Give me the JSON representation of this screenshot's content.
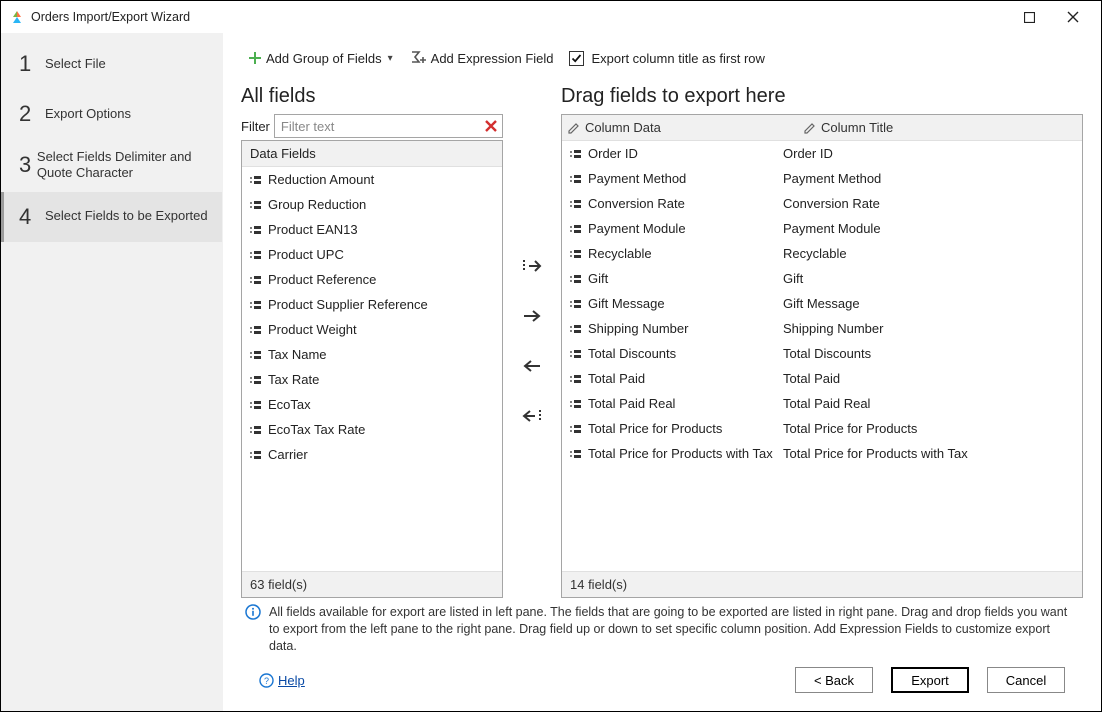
{
  "window": {
    "title": "Orders Import/Export Wizard"
  },
  "steps": [
    {
      "num": "1",
      "label": "Select File"
    },
    {
      "num": "2",
      "label": "Export Options"
    },
    {
      "num": "3",
      "label": "Select Fields Delimiter and Quote Character"
    },
    {
      "num": "4",
      "label": "Select Fields to be Exported"
    }
  ],
  "active_step_index": 3,
  "toolbar": {
    "add_group": "Add Group of Fields",
    "add_expr": "Add Expression Field",
    "export_first_row": "Export column title as first row",
    "export_first_row_checked": true
  },
  "left": {
    "title": "All fields",
    "filter_label": "Filter",
    "filter_placeholder": "Filter text",
    "header": "Data Fields",
    "items": [
      "Reduction Amount",
      "Group Reduction",
      "Product EAN13",
      "Product UPC",
      "Product Reference",
      "Product Supplier Reference",
      "Product Weight",
      "Tax Name",
      "Tax Rate",
      "EcoTax",
      "EcoTax Tax Rate",
      "Carrier"
    ],
    "count": "63 field(s)"
  },
  "right": {
    "title": "Drag fields to export here",
    "col1": "Column Data",
    "col2": "Column Title",
    "rows": [
      {
        "data": "Order ID",
        "title": "Order ID"
      },
      {
        "data": "Payment Method",
        "title": "Payment Method"
      },
      {
        "data": "Conversion Rate",
        "title": "Conversion Rate"
      },
      {
        "data": "Payment Module",
        "title": "Payment Module"
      },
      {
        "data": "Recyclable",
        "title": "Recyclable"
      },
      {
        "data": "Gift",
        "title": "Gift"
      },
      {
        "data": "Gift Message",
        "title": "Gift Message"
      },
      {
        "data": "Shipping Number",
        "title": "Shipping Number"
      },
      {
        "data": "Total Discounts",
        "title": "Total Discounts"
      },
      {
        "data": "Total Paid",
        "title": "Total Paid"
      },
      {
        "data": "Total Paid Real",
        "title": "Total Paid Real"
      },
      {
        "data": "Total Price for Products",
        "title": "Total Price for Products"
      },
      {
        "data": "Total Price for Products with Tax",
        "title": "Total Price for Products with Tax"
      }
    ],
    "count": "14 field(s)"
  },
  "info": "All fields available for export are listed in left pane. The fields that are going to be exported are listed in right pane. Drag and drop fields you want to export from the left pane to the right pane. Drag field up or down to set specific column position. Add Expression Fields to customize export data.",
  "help": "Help",
  "buttons": {
    "back": "< Back",
    "export": "Export",
    "cancel": "Cancel"
  }
}
